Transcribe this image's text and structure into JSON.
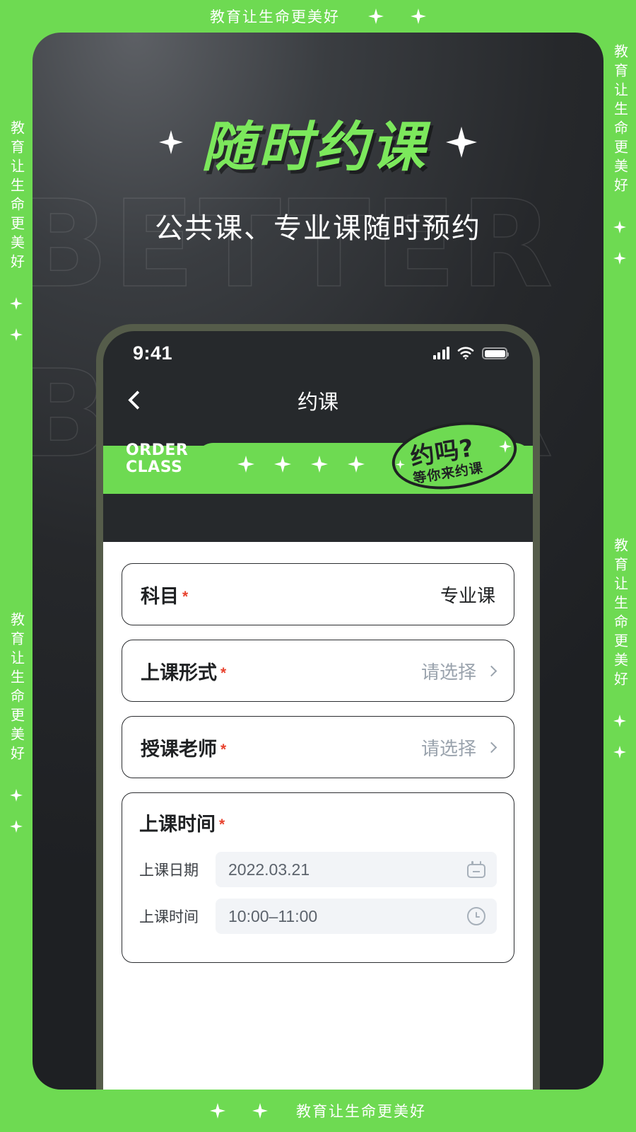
{
  "poster": {
    "brand_slogan": "教育让生命更美好",
    "green": "#6EDA52",
    "hero_title": "随时约课",
    "hero_subtitle": "公共课、专业课随时预约",
    "background_word": "BETTER"
  },
  "phone": {
    "status": {
      "time": "9:41",
      "signal_icon": "signal-bars-icon",
      "wifi_icon": "wifi-icon",
      "battery_icon": "battery-icon"
    },
    "nav": {
      "back_icon": "back-chevron-icon",
      "title": "约课"
    },
    "banner": {
      "en_line1": "ORDER",
      "en_line2": "CLASS",
      "badge_main": "约吗?",
      "badge_sub": "等你来约课",
      "sparkle_icon": "sparkle-star-icon"
    },
    "form": {
      "fields": [
        {
          "label": "科目",
          "required": "*",
          "value": "专业课",
          "has_chevron": false
        },
        {
          "label": "上课形式",
          "required": "*",
          "placeholder": "请选择",
          "has_chevron": true
        },
        {
          "label": "授课老师",
          "required": "*",
          "placeholder": "请选择",
          "has_chevron": true
        }
      ],
      "time_block": {
        "title": "上课时间",
        "required": "*",
        "date_label": "上课日期",
        "date_value": "2022.03.21",
        "date_icon": "calendar-icon",
        "time_label": "上课时间",
        "time_value": "10:00–11:00",
        "time_icon": "clock-icon"
      }
    }
  }
}
